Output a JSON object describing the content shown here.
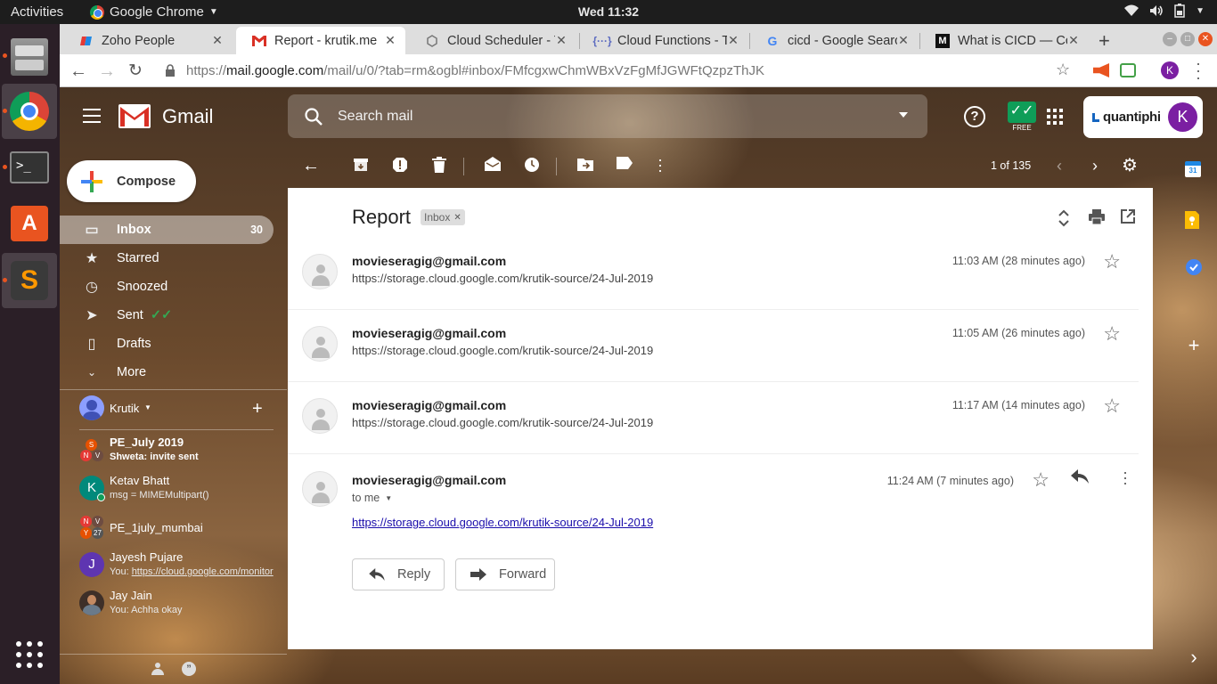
{
  "system": {
    "activities": "Activities",
    "app_menu": "Google Chrome",
    "clock": "Wed 11:32"
  },
  "browser": {
    "tabs": [
      {
        "title": "Zoho People",
        "active": false
      },
      {
        "title": "Report - krutik.me",
        "active": true
      },
      {
        "title": "Cloud Scheduler - T",
        "active": false
      },
      {
        "title": "Cloud Functions - T",
        "active": false
      },
      {
        "title": "cicd - Google Searc",
        "active": false
      },
      {
        "title": "What is CICD — Co",
        "active": false
      }
    ],
    "url_scheme": "https://",
    "url_host": "mail.google.com",
    "url_path": "/mail/u/0/?tab=rm&ogbl#inbox/FMfcgxwChmWBxVzFgMfJGWFtQzpzThJK",
    "profile_initial": "K"
  },
  "gmail": {
    "wordmark": "Gmail",
    "search_placeholder": "Search mail",
    "free_badge": "FREE",
    "account_brand": "quantiphi",
    "account_initial": "K",
    "compose_label": "Compose",
    "nav": [
      {
        "label": "Inbox",
        "count": "30",
        "active": true
      },
      {
        "label": "Starred"
      },
      {
        "label": "Snoozed"
      },
      {
        "label": "Sent"
      },
      {
        "label": "Drafts"
      },
      {
        "label": "More"
      }
    ],
    "hangouts_user": "Krutik",
    "hangouts": [
      {
        "name": "PE_July 2019",
        "msg": "Shweta: invite sent",
        "bold": true
      },
      {
        "name": "Ketav Bhatt",
        "msg": "msg = MIMEMultipart()",
        "initial": "K"
      },
      {
        "name": "PE_1july_mumbai",
        "msg": "",
        "badge": "27"
      },
      {
        "name": "Jayesh Pujare",
        "msg_prefix": "You: ",
        "msg": "https://cloud.google.com/monitor",
        "initial": "J"
      },
      {
        "name": "Jay Jain",
        "msg": "You: Achha okay"
      }
    ],
    "pager": "1 of 135",
    "thread": {
      "subject": "Report",
      "label": "Inbox",
      "messages": [
        {
          "from": "movieseragig@gmail.com",
          "snippet": "https://storage.cloud.google.com/krutik-source/24-Jul-2019",
          "time": "11:03 AM (28 minutes ago)"
        },
        {
          "from": "movieseragig@gmail.com",
          "snippet": "https://storage.cloud.google.com/krutik-source/24-Jul-2019",
          "time": "11:05 AM (26 minutes ago)"
        },
        {
          "from": "movieseragig@gmail.com",
          "snippet": "https://storage.cloud.google.com/krutik-source/24-Jul-2019",
          "time": "11:17 AM (14 minutes ago)"
        }
      ],
      "expanded": {
        "from": "movieseragig@gmail.com",
        "to": "to me",
        "time": "11:24 AM (7 minutes ago)",
        "body_link": "https://storage.cloud.google.com/krutik-source/24-Jul-2019",
        "reply_label": "Reply",
        "forward_label": "Forward"
      }
    },
    "calendar_day": "31"
  }
}
